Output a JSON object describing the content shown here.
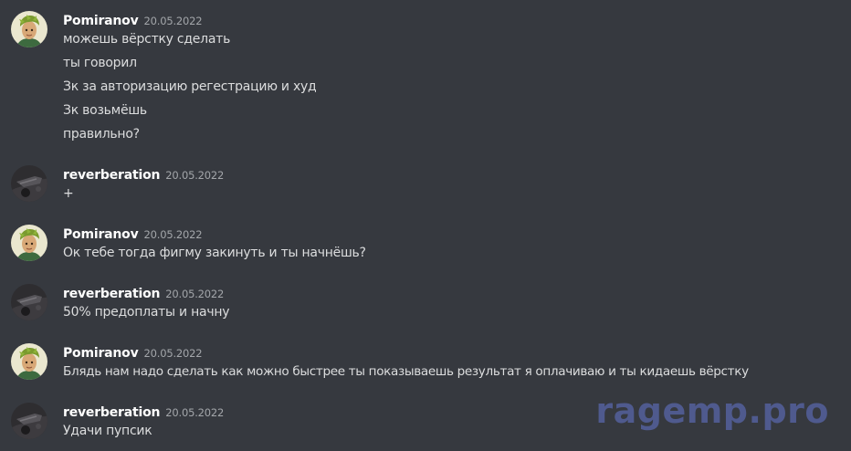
{
  "watermark": "ragemp.pro",
  "groups": [
    {
      "author": "Pomiranov",
      "date": "20.05.2022",
      "avatar": "pomiranov-avatar-icon",
      "messages": [
        "можешь вёрстку сделать",
        "ты говорил",
        "Зк за авторизацию регестрацию и худ",
        "Зк возьмёшь",
        "правильно?"
      ]
    },
    {
      "author": "reverberation",
      "date": "20.05.2022",
      "avatar": "reverberation-avatar-icon",
      "messages": [
        "+"
      ]
    },
    {
      "author": "Pomiranov",
      "date": "20.05.2022",
      "avatar": "pomiranov-avatar-icon",
      "messages": [
        "Ок тебе тогда фигму закинуть и ты начнёшь?"
      ]
    },
    {
      "author": "reverberation",
      "date": "20.05.2022",
      "avatar": "reverberation-avatar-icon",
      "messages": [
        "50% предоплаты и начну"
      ]
    },
    {
      "author": "Pomiranov",
      "date": "20.05.2022",
      "avatar": "pomiranov-avatar-icon",
      "messages": [
        "Блядь нам надо сделать как можно быстрее ты показываешь результат я оплачиваю и ты кидаешь вёрстку"
      ]
    },
    {
      "author": "reverberation",
      "date": "20.05.2022",
      "avatar": "reverberation-avatar-icon",
      "messages": [
        "Удачи пупсик"
      ]
    }
  ]
}
